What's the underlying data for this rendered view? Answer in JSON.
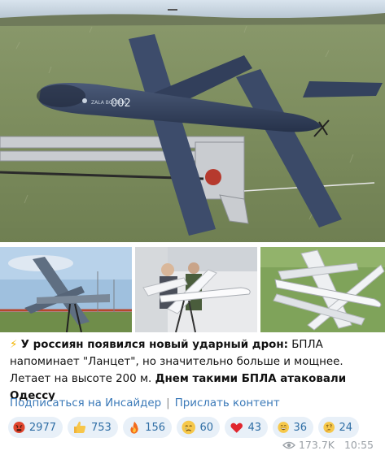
{
  "post": {
    "text_lead_emoji": "⚡",
    "text_bold_1": "У россиян появился новый ударный дрон:",
    "text_plain": " БПЛА напоминает \"Ланцет\", но значительно больше и мощнее. Летает на высоте 200 м. ",
    "text_bold_2": "Днем такими БПЛА атаковали Одессу",
    "drone_marking": "002"
  },
  "links": {
    "subscribe": "Подписаться на Инсайдер",
    "separator": "|",
    "submit": "Прислать контент"
  },
  "reactions": [
    {
      "icon": "angry-face-icon",
      "count": "2977"
    },
    {
      "icon": "thumbs-up-icon",
      "count": "753"
    },
    {
      "icon": "fire-icon",
      "count": "156"
    },
    {
      "icon": "crying-face-icon",
      "count": "60"
    },
    {
      "icon": "heart-icon",
      "count": "43"
    },
    {
      "icon": "grinning-face-icon",
      "count": "36"
    },
    {
      "icon": "thinking-face-icon",
      "count": "24"
    }
  ],
  "meta": {
    "views": "173.7K",
    "time": "10:55"
  },
  "colors": {
    "link": "#3a79b8",
    "reaction_bg": "#e8f0f8",
    "reaction_text": "#2f6ea5",
    "meta_text": "#9aa0a6"
  }
}
